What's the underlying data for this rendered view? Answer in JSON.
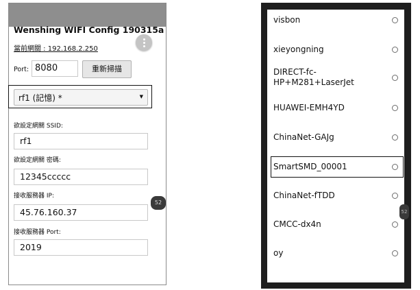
{
  "left_screen": {
    "app_title": "Wenshing WIFI Config 190315a",
    "current_gateway": "當前網關 : 192.168.2.250",
    "port_label": "Port:",
    "port_value": "8080",
    "rescan_button": "重新掃描",
    "network_select_value": "rf1 (記憶) *",
    "ssid_label": "欲設定網關 SSID:",
    "ssid_value": "rf1",
    "password_label": "欲設定網關 密碼:",
    "password_value": "12345ccccc",
    "server_ip_label": "接收服務器 IP:",
    "server_ip_value": "45.76.160.37",
    "server_port_label": "接收服務器 Port:",
    "server_port_value": "2019",
    "side_badge": "52",
    "menu_icon": "more-vertical-icon"
  },
  "right_screen": {
    "networks": [
      {
        "ssid": "visbon",
        "selected": false
      },
      {
        "ssid": "xieyongning",
        "selected": false
      },
      {
        "ssid": "DIRECT-fc-\nHP+M281+LaserJet",
        "selected": false
      },
      {
        "ssid": "HUAWEI-EMH4YD",
        "selected": false
      },
      {
        "ssid": "ChinaNet-GAJg",
        "selected": false
      },
      {
        "ssid": "SmartSMD_00001",
        "selected": false
      },
      {
        "ssid": "ChinaNet-fTDD",
        "selected": false
      },
      {
        "ssid": "CMCC-dx4n",
        "selected": false
      },
      {
        "ssid": "oy",
        "selected": false
      }
    ],
    "side_badge": "52"
  }
}
